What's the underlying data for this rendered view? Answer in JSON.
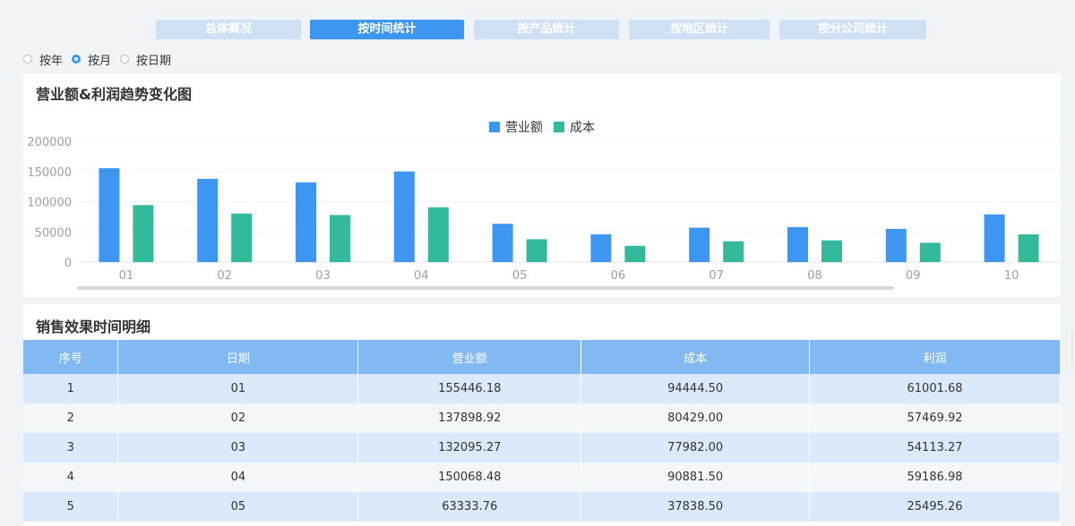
{
  "tabs": [
    {
      "label": "总体概况",
      "active": false
    },
    {
      "label": "按时间统计",
      "active": true
    },
    {
      "label": "按产品统计",
      "active": false
    },
    {
      "label": "按地区统计",
      "active": false
    },
    {
      "label": "按分公司统计",
      "active": false
    }
  ],
  "radios": [
    {
      "label": "按年",
      "checked": false
    },
    {
      "label": "按月",
      "checked": true
    },
    {
      "label": "按日期",
      "checked": false
    }
  ],
  "chart_section": {
    "title": "营业额&利润趋势变化图"
  },
  "chart_data": {
    "type": "bar",
    "title": "营业额&利润趋势变化图",
    "categories": [
      "01",
      "02",
      "03",
      "04",
      "05",
      "06",
      "07",
      "08",
      "09",
      "10"
    ],
    "series": [
      {
        "name": "营业额",
        "color": "#3d96f2",
        "values": [
          155446.18,
          137898.92,
          132095.27,
          150068.48,
          63333.76,
          46000,
          57000,
          58000,
          55000,
          79000
        ]
      },
      {
        "name": "成本",
        "color": "#33b99b",
        "values": [
          94444.5,
          80429.0,
          77982.0,
          90881.5,
          37838.5,
          27000,
          34500,
          36000,
          32000,
          46000
        ]
      }
    ],
    "yticks": [
      "200000",
      "150000",
      "100000",
      "50000",
      "0"
    ],
    "ylim": [
      0,
      200000
    ],
    "legend_position": "top-center",
    "grid": true
  },
  "table_section": {
    "title": "销售效果时间明细",
    "headers": [
      "序号",
      "日期",
      "营业额",
      "成本",
      "利润"
    ],
    "rows": [
      [
        "1",
        "01",
        "155446.18",
        "94444.50",
        "61001.68"
      ],
      [
        "2",
        "02",
        "137898.92",
        "80429.00",
        "57469.92"
      ],
      [
        "3",
        "03",
        "132095.27",
        "77982.00",
        "54113.27"
      ],
      [
        "4",
        "04",
        "150068.48",
        "90881.50",
        "59186.98"
      ],
      [
        "5",
        "05",
        "63333.76",
        "37838.50",
        "25495.26"
      ]
    ]
  }
}
